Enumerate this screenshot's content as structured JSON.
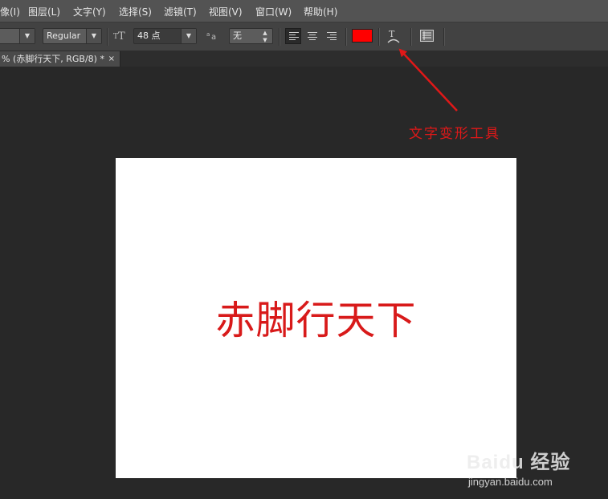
{
  "menu": {
    "items": [
      "像(I)",
      "图层(L)",
      "文字(Y)",
      "选择(S)",
      "滤镜(T)",
      "视图(V)",
      "窗口(W)",
      "帮助(H)"
    ]
  },
  "options": {
    "font_style": "Regular",
    "font_size": "48 点",
    "antialias": "无",
    "text_color": "#ff0000",
    "icons": {
      "size": "font-size-icon",
      "antialias": "antialias-icon",
      "warp": "warp-text-icon",
      "panel": "character-panel-icon"
    }
  },
  "document": {
    "tab_title": "% (赤脚行天下, RGB/8) *",
    "close": "×"
  },
  "canvas": {
    "text": "赤脚行天下",
    "text_color": "#d81a1a"
  },
  "annotation": {
    "label": "文字变形工具",
    "color": "#e01818"
  },
  "watermark": {
    "brand": "Baidu 经验",
    "url": "jingyan.baidu.com"
  }
}
